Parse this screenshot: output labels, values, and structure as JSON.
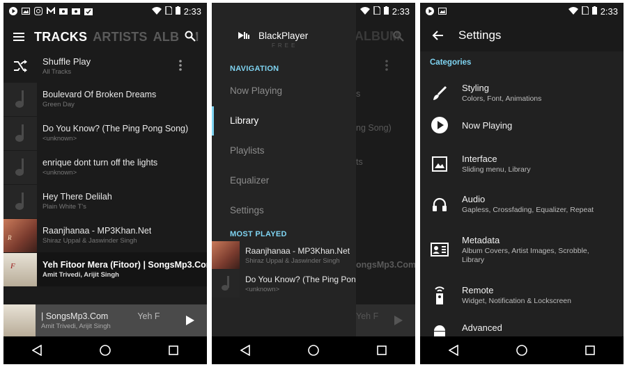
{
  "status": {
    "time": "2:33"
  },
  "screen1": {
    "tabs": [
      "TRACKS",
      "ARTISTS",
      "ALBUM"
    ],
    "shuffle": {
      "title": "Shuffle Play",
      "subtitle": "All Tracks"
    },
    "tracks": [
      {
        "title": "Boulevard Of Broken Dreams",
        "artist": "Green Day",
        "art": "note"
      },
      {
        "title": "Do You Know? (The Ping Pong Song)",
        "artist": "<unknown>",
        "art": "note"
      },
      {
        "title": "enrique dont turn off the lights",
        "artist": "<unknown>",
        "art": "note"
      },
      {
        "title": "Hey There Delilah",
        "artist": "Plain White T's",
        "art": "note"
      },
      {
        "title": "Raanjhanaa - MP3Khan.Net",
        "artist": "Shiraz Uppal & Jaswinder Singh",
        "art": "cover-raanjhanaa"
      },
      {
        "title": "Yeh Fitoor Mera (Fitoor) |  SongsMp3.Com",
        "artist": "Amit Trivedi, Arijit Singh",
        "art": "cover-fitoor"
      }
    ],
    "now_playing": {
      "title": "|  SongsMp3.Com",
      "title_tail": "Yeh F",
      "artist": "Amit Trivedi, Arijit Singh"
    }
  },
  "screen2": {
    "app_name": "BlackPlayer",
    "app_sub": "FREE",
    "navigation_header": "NAVIGATION",
    "nav_items": [
      "Now Playing",
      "Library",
      "Playlists",
      "Equalizer",
      "Settings"
    ],
    "active_item": "Library",
    "most_played_header": "MOST PLAYED",
    "most_played": [
      {
        "title": "Raanjhanaa - MP3Khan.Net",
        "artist": "Shiraz Uppal & Jaswinder Singh"
      },
      {
        "title": "Do You Know? (The Ping Pong S",
        "artist": "<unknown>"
      }
    ],
    "behind": {
      "tab": "ALBUM",
      "t1": "s",
      "t2": "ng Song)",
      "t3": "ts",
      "t4": "ongsMp3.Com",
      "t5": "Yeh F"
    }
  },
  "screen3": {
    "title": "Settings",
    "section": "Categories",
    "items": [
      {
        "title": "Styling",
        "subtitle": "Colors, Font, Animations",
        "icon": "brush-icon"
      },
      {
        "title": "Now Playing",
        "subtitle": "",
        "icon": "play-circle-icon"
      },
      {
        "title": "Interface",
        "subtitle": "Sliding menu, Library",
        "icon": "image-icon"
      },
      {
        "title": "Audio",
        "subtitle": "Gapless, Crossfading, Equalizer, Repeat",
        "icon": "headphones-icon"
      },
      {
        "title": "Metadata",
        "subtitle": "Album Covers, Artist Images, Scrobble, Library",
        "icon": "contact-card-icon"
      },
      {
        "title": "Remote",
        "subtitle": "Widget, Notification & Lockscreen",
        "icon": "remote-icon"
      },
      {
        "title": "Advanced",
        "subtitle": "",
        "icon": "android-icon"
      }
    ]
  },
  "colors": {
    "accent": "#7fd4f2",
    "background": "#1b1b1b",
    "drawer": "#242424"
  }
}
